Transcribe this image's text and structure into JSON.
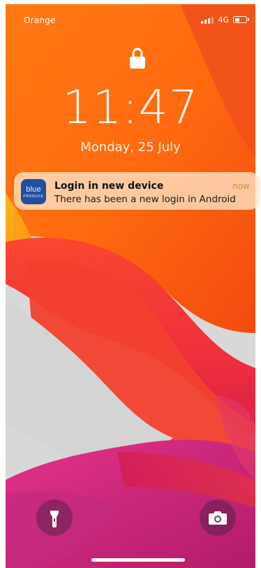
{
  "status_bar": {
    "carrier": "Orange",
    "network": "4G",
    "battery_level": 0.45
  },
  "lock_screen": {
    "time": "11:47",
    "date": "Monday, 25 July"
  },
  "notification": {
    "app_icon_text": "blue",
    "app_icon_subtext": "PRODUCE",
    "title": "Login in new device",
    "body": "There has been a new login in Android",
    "time": "now"
  },
  "icons": {
    "lock": "lock-icon",
    "flashlight": "flashlight-icon",
    "camera": "camera-icon"
  },
  "colors": {
    "notification_time": "#d88a3a",
    "app_icon_bg": "#1f4fa0",
    "wallpaper_orange": "#ff6a1a",
    "wallpaper_red": "#f0303a",
    "wallpaper_magenta": "#d82c7e",
    "wallpaper_gray": "#d6d6d6"
  }
}
